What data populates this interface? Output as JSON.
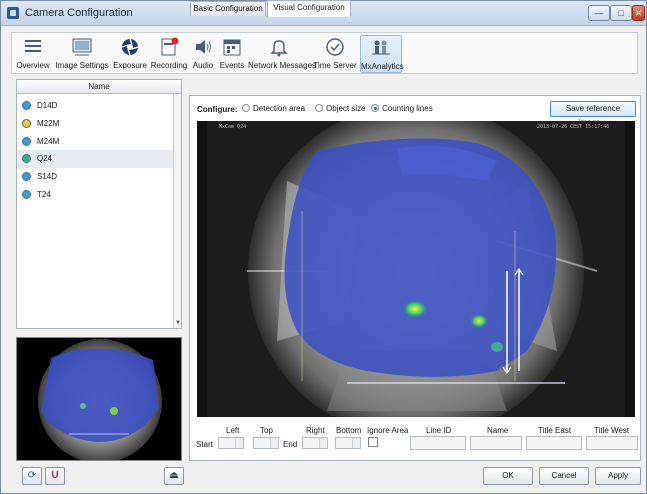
{
  "window": {
    "title": "Camera Configuration"
  },
  "toolbar": {
    "items": [
      {
        "label": "Overview",
        "icon": "overview-icon"
      },
      {
        "label": "Image Settings",
        "icon": "image-settings-icon"
      },
      {
        "label": "Exposure",
        "icon": "exposure-icon"
      },
      {
        "label": "Recording",
        "icon": "recording-icon"
      },
      {
        "label": "Audio",
        "icon": "audio-icon"
      },
      {
        "label": "Events",
        "icon": "events-icon"
      },
      {
        "label": "Network Messages",
        "icon": "network-messages-icon"
      },
      {
        "label": "Time Server",
        "icon": "time-server-icon"
      },
      {
        "label": "MxAnalytics",
        "icon": "mxanalytics-icon",
        "active": true
      }
    ]
  },
  "camera_list": {
    "header": "Name",
    "items": [
      {
        "name": "D14D",
        "color": "#3d9bd6"
      },
      {
        "name": "M22M",
        "color": "#f2c230"
      },
      {
        "name": "M24M",
        "color": "#3d9bd6"
      },
      {
        "name": "Q24",
        "color": "#36b08a",
        "selected": true
      },
      {
        "name": "S14D",
        "color": "#3d9bd6"
      },
      {
        "name": "T24",
        "color": "#3d9bd6"
      }
    ]
  },
  "tabs": [
    {
      "label": "Basic Configuration",
      "active": false
    },
    {
      "label": "Visual Configuration",
      "active": true
    }
  ],
  "configure": {
    "label": "Configure:",
    "options": [
      {
        "label": "Detection area",
        "selected": false
      },
      {
        "label": "Object size",
        "selected": false
      },
      {
        "label": "Counting lines",
        "selected": true
      }
    ],
    "reference_button": "Save reference image..."
  },
  "fields": {
    "start_label": "Start",
    "left_label": "Left",
    "top_label": "Top",
    "end_label": "End",
    "right_label": "Right",
    "bottom_label": "Bottom",
    "ignore_area_label": "Ignore Area",
    "line_id_label": "Line ID",
    "name_label": "Name",
    "title_east_label": "Title East",
    "title_west_label": "Title West"
  },
  "buttons": {
    "ok": "OK",
    "cancel": "Cancel",
    "apply": "Apply"
  },
  "colors": {
    "heatmap": "#3a4fc4",
    "counting_line": "#e8e0ff",
    "selection_tab": "#9bb8dd"
  }
}
